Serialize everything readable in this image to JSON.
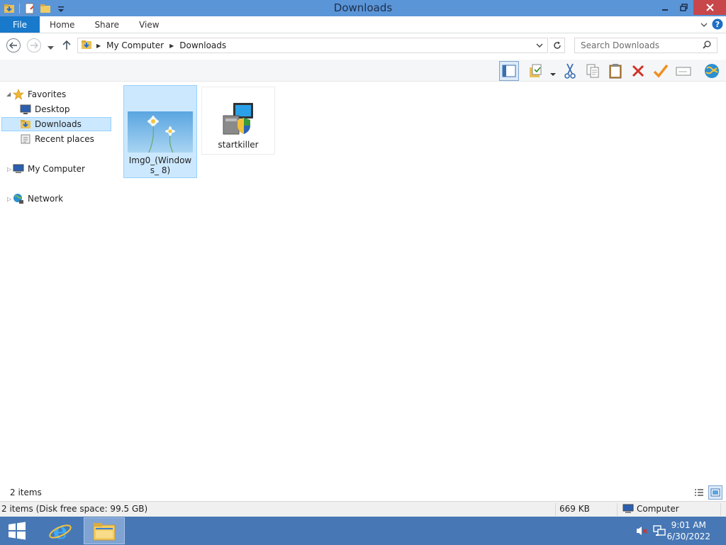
{
  "window": {
    "title": "Downloads"
  },
  "ribbon": {
    "file_label": "File",
    "tabs": [
      "Home",
      "Share",
      "View"
    ]
  },
  "address": {
    "crumbs": [
      "My Computer",
      "Downloads"
    ]
  },
  "search": {
    "placeholder": "Search Downloads"
  },
  "nav": {
    "favorites": "Favorites",
    "desktop": "Desktop",
    "downloads": "Downloads",
    "recent": "Recent places",
    "computer": "My Computer",
    "network": "Network"
  },
  "files": [
    {
      "name": "Img0_(Windows_ 8)",
      "type": "image",
      "selected": true
    },
    {
      "name": "startkiller",
      "type": "installer",
      "selected": false
    }
  ],
  "status": {
    "item_count": "2 items",
    "detail": "2 items (Disk free space: 99.5 GB)",
    "size": "669 KB",
    "location": "Computer"
  },
  "taskbar": {
    "time": "9:01 AM",
    "date": "6/30/2022"
  },
  "colors": {
    "titlebar": "#5a95d8",
    "file_tab": "#1979ca",
    "selection": "#cce8ff",
    "taskbar": "#4778b5"
  }
}
